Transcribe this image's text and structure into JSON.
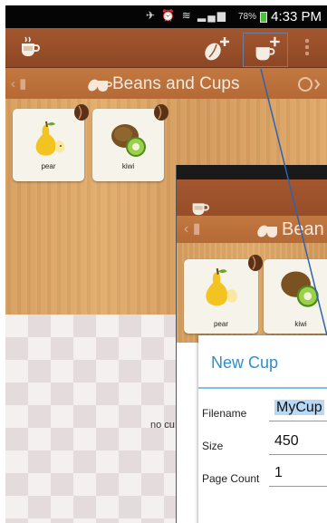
{
  "status_bar": {
    "battery": "78%",
    "time": "4:33 PM"
  },
  "nav": {
    "title": "Beans and Cups"
  },
  "cards": [
    {
      "label": "pear",
      "icon": "pear-icon"
    },
    {
      "label": "kiwi",
      "icon": "kiwi-icon"
    }
  ],
  "empty": {
    "text": "no cu"
  },
  "inset": {
    "nav_title": "Bean",
    "cards": [
      {
        "label": "pear"
      },
      {
        "label": "kiwi"
      }
    ],
    "dialog": {
      "title": "New Cup",
      "fields": [
        {
          "label": "Filename",
          "value": "MyCup"
        },
        {
          "label": "Size",
          "value": "450"
        },
        {
          "label": "Page Count",
          "value": "1"
        }
      ]
    }
  },
  "colors": {
    "action_bar": "#9a502a",
    "nav_bar": "#bd7239",
    "dialog_title": "#2c8fcf",
    "callout": "#2a63b3"
  }
}
